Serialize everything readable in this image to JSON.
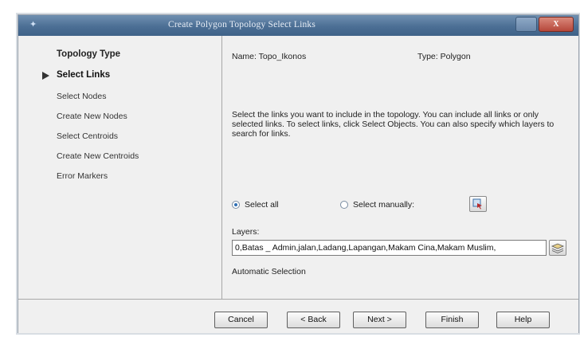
{
  "window": {
    "title": "Create Polygon Topology   Select Links",
    "minimize_label": "",
    "close_label": "X"
  },
  "sidebar": {
    "header": "Topology Type",
    "active_step": "Select Links",
    "steps": [
      "Select Nodes",
      "Create New Nodes",
      "Select Centroids",
      "Create New Centroids",
      "Error Markers"
    ]
  },
  "main": {
    "name_text": "Name: Topo_Ikonos",
    "type_text": "Type: Polygon",
    "description": "Select the links you want to include in the topology. You can include all links or only selected links. To select links, click Select Objects. You can also specify which layers to search for links.",
    "select_all_label": "Select all",
    "select_manually_label": "Select manually:",
    "selected_option": "select_all",
    "layers_label": "Layers:",
    "layers_value": "0,Batas _ Admin,jalan,Ladang,Lapangan,Makam Cina,Makam Muslim,",
    "automatic_selection_label": "Automatic Selection"
  },
  "footer": {
    "cancel_label": "Cancel",
    "back_label": "< Back",
    "next_label": "Next >",
    "finish_label": "Finish",
    "help_label": "Help"
  }
}
